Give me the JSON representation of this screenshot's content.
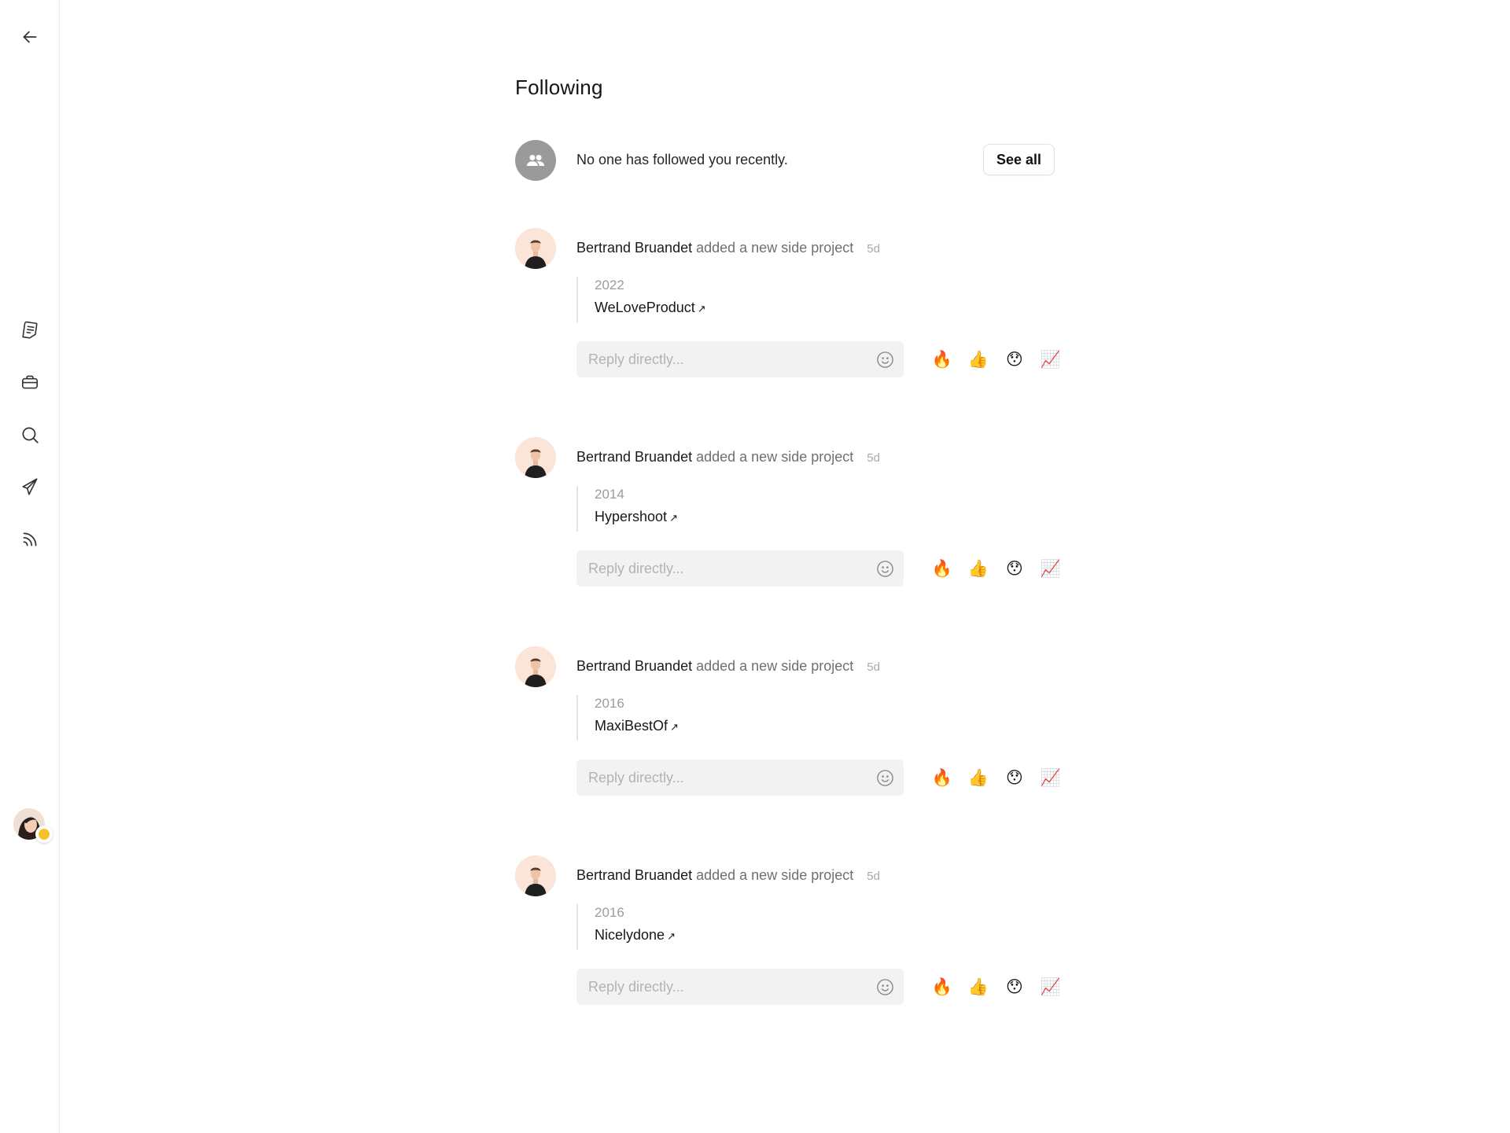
{
  "sidebar": {
    "icons": [
      "back-arrow-icon",
      "document-icon",
      "briefcase-icon",
      "search-icon",
      "send-icon",
      "feed-icon"
    ]
  },
  "page": {
    "title": "Following"
  },
  "followers": {
    "message": "No one has followed you recently.",
    "see_all_label": "See all"
  },
  "feed": [
    {
      "name": "Bertrand Bruandet",
      "action": "added a new side project",
      "time": "5d",
      "year": "2022",
      "project": "WeLoveProduct",
      "reply_placeholder": "Reply directly..."
    },
    {
      "name": "Bertrand Bruandet",
      "action": "added a new side project",
      "time": "5d",
      "year": "2014",
      "project": "Hypershoot",
      "reply_placeholder": "Reply directly..."
    },
    {
      "name": "Bertrand Bruandet",
      "action": "added a new side project",
      "time": "5d",
      "year": "2016",
      "project": "MaxiBestOf",
      "reply_placeholder": "Reply directly..."
    },
    {
      "name": "Bertrand Bruandet",
      "action": "added a new side project",
      "time": "5d",
      "year": "2016",
      "project": "Nicelydone",
      "reply_placeholder": "Reply directly..."
    }
  ],
  "reactions": {
    "fire": "🔥",
    "thumbs_up": "👍",
    "hushed": "😯",
    "chart": "📈"
  },
  "colors": {
    "reply_bg": "#f2f2f2",
    "avatar_bg": "#fbe4d8",
    "group_avatar_bg": "#9a9a9a",
    "muted_text": "#6f6f6f"
  }
}
